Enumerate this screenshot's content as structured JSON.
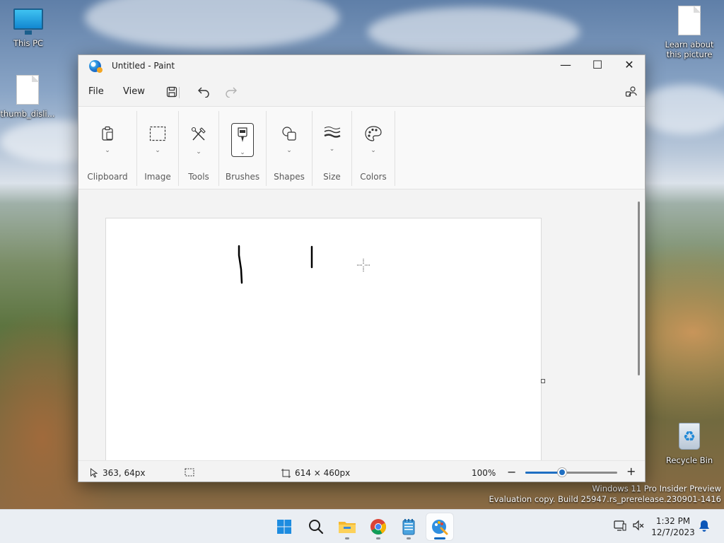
{
  "desktop": {
    "icons": [
      {
        "label": "This PC"
      },
      {
        "label": "thumb_disli..."
      },
      {
        "label": "Learn about this picture"
      },
      {
        "label": "Recycle Bin"
      }
    ],
    "watermark": {
      "line1": "Windows 11 Pro Insider Preview",
      "line2": "Evaluation copy. Build 25947.rs_prerelease.230901-1416"
    }
  },
  "window": {
    "title": "Untitled - Paint",
    "caption": {
      "minimize": "—",
      "maximize": "☐",
      "close": "✕"
    },
    "menu": {
      "file": "File",
      "view": "View"
    },
    "ribbon": {
      "groups": [
        {
          "label": "Clipboard",
          "icon": "clipboard-icon"
        },
        {
          "label": "Image",
          "icon": "selection-icon"
        },
        {
          "label": "Tools",
          "icon": "tools-icon"
        },
        {
          "label": "Brushes",
          "icon": "brush-icon",
          "active": true
        },
        {
          "label": "Shapes",
          "icon": "shapes-icon"
        },
        {
          "label": "Size",
          "icon": "size-icon"
        },
        {
          "label": "Colors",
          "icon": "palette-icon"
        }
      ]
    },
    "status": {
      "cursor_position": "363, 64px",
      "canvas_size": "614 × 460px",
      "zoom_level": "100%",
      "zoom_fraction": 0.4
    },
    "accent_color": "#1f6fc2"
  },
  "taskbar": {
    "apps": [
      {
        "name": "start"
      },
      {
        "name": "search"
      },
      {
        "name": "file-explorer"
      },
      {
        "name": "chrome"
      },
      {
        "name": "notepad"
      },
      {
        "name": "paint",
        "active": true
      }
    ],
    "clock": {
      "time": "1:32 PM",
      "date": "12/7/2023"
    }
  }
}
